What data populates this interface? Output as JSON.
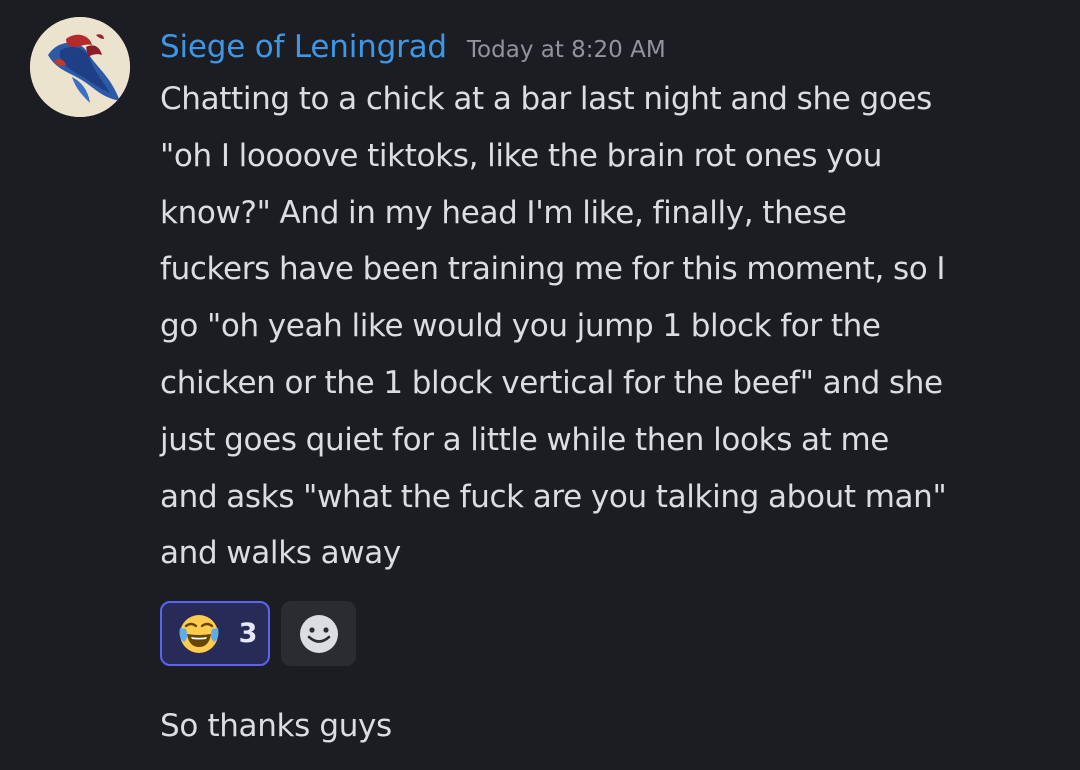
{
  "message": {
    "username": "Siege of Leningrad",
    "username_color": "#3d97e6",
    "timestamp": "Today at 8:20 AM",
    "body": "Chatting to a chick at a bar last night and she goes\n\"oh I loooove tiktoks, like the brain rot ones you\nknow?\" And in my head I'm like, finally, these\nfuckers have been training me for this moment, so I\ngo \"oh yeah like would you jump 1 block for the\nchicken or the 1 block vertical for the beef\" and she\njust goes quiet for a little while then looks at me\nand asks \"what the fuck are you talking about man\"\nand walks away"
  },
  "reactions": [
    {
      "emoji": "face-with-tears-of-joy",
      "count": "3",
      "selected": true,
      "accent": "#5865f2"
    },
    {
      "icon": "add-reaction-smile-icon"
    }
  ],
  "followup_message": {
    "body": "So thanks guys"
  }
}
